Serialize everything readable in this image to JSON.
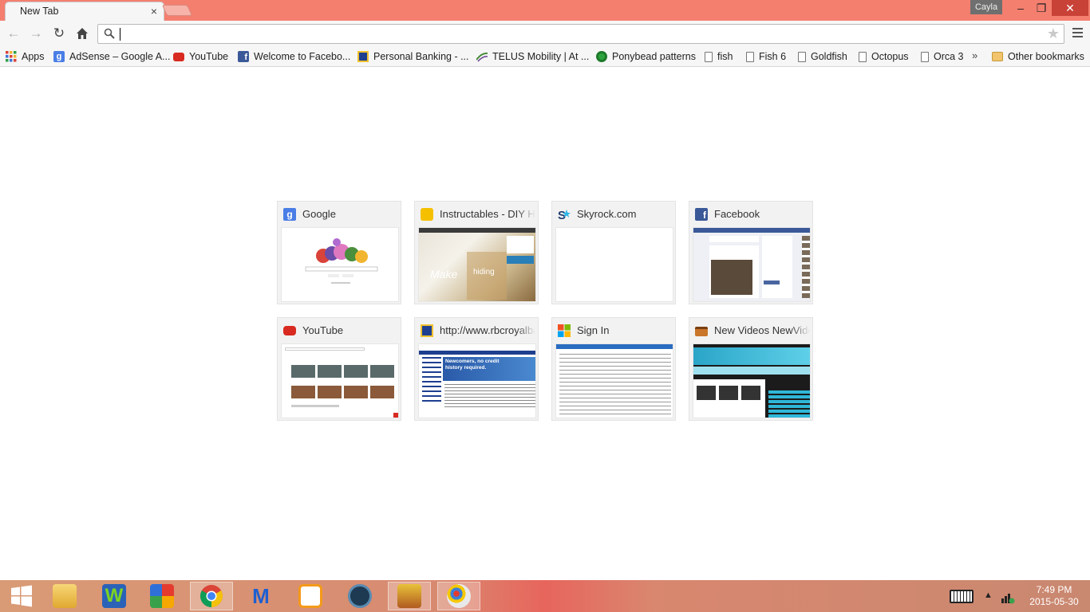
{
  "browser": {
    "tab_title": "New Tab",
    "tab_close": "×",
    "profile_name": "Cayla",
    "omnibox_value": "",
    "omnibox_placeholder": "",
    "window_buttons": {
      "minimize": "–",
      "maximize": "❐",
      "close": "✕"
    },
    "nav": {
      "back": "←",
      "forward": "→",
      "reload": "↻",
      "home": "⌂",
      "star": "★"
    }
  },
  "bookmarks": [
    {
      "label": "Apps",
      "icon": "apps-grid-icon"
    },
    {
      "label": "AdSense – Google A...",
      "icon": "google-icon"
    },
    {
      "label": "YouTube",
      "icon": "youtube-icon"
    },
    {
      "label": "Welcome to Facebo...",
      "icon": "facebook-icon"
    },
    {
      "label": "Personal Banking - ...",
      "icon": "rbc-icon"
    },
    {
      "label": "TELUS Mobility | At ...",
      "icon": "telus-icon"
    },
    {
      "label": "Ponybead patterns",
      "icon": "green-circle-icon"
    },
    {
      "label": "fish",
      "icon": "document-icon"
    },
    {
      "label": "Fish 6",
      "icon": "document-icon"
    },
    {
      "label": "Goldfish",
      "icon": "document-icon"
    },
    {
      "label": "Octopus",
      "icon": "document-icon"
    },
    {
      "label": "Orca 3",
      "icon": "document-icon"
    }
  ],
  "bookmarks_more": "»",
  "other_bookmarks": "Other bookmarks",
  "most_visited": [
    {
      "title": "Google",
      "icon": "google-icon"
    },
    {
      "title": "Instructables - DIY How To",
      "icon": "instructables-icon"
    },
    {
      "title": "Skyrock.com",
      "icon": "skyrock-icon"
    },
    {
      "title": "Facebook",
      "icon": "facebook-icon"
    },
    {
      "title": "YouTube",
      "icon": "youtube-icon"
    },
    {
      "title": "http://www.rbcroyalbank.com",
      "icon": "rbc-icon"
    },
    {
      "title": "Sign In",
      "icon": "microsoft-icon"
    },
    {
      "title": "New Videos NewVideos",
      "icon": "tv-icon"
    }
  ],
  "thumb_text": {
    "instructables_hiding": "hiding",
    "instructables_make": "Make",
    "rbc_headline": "Newcomers, no credit history required."
  },
  "taskbar": {
    "time": "7:49 PM",
    "date": "2015-05-30"
  },
  "colors": {
    "titlebar": "#f47f6f",
    "close_button": "#c94237",
    "toolbar": "#f6f6f6",
    "tile_bg": "#f2f2f2"
  }
}
